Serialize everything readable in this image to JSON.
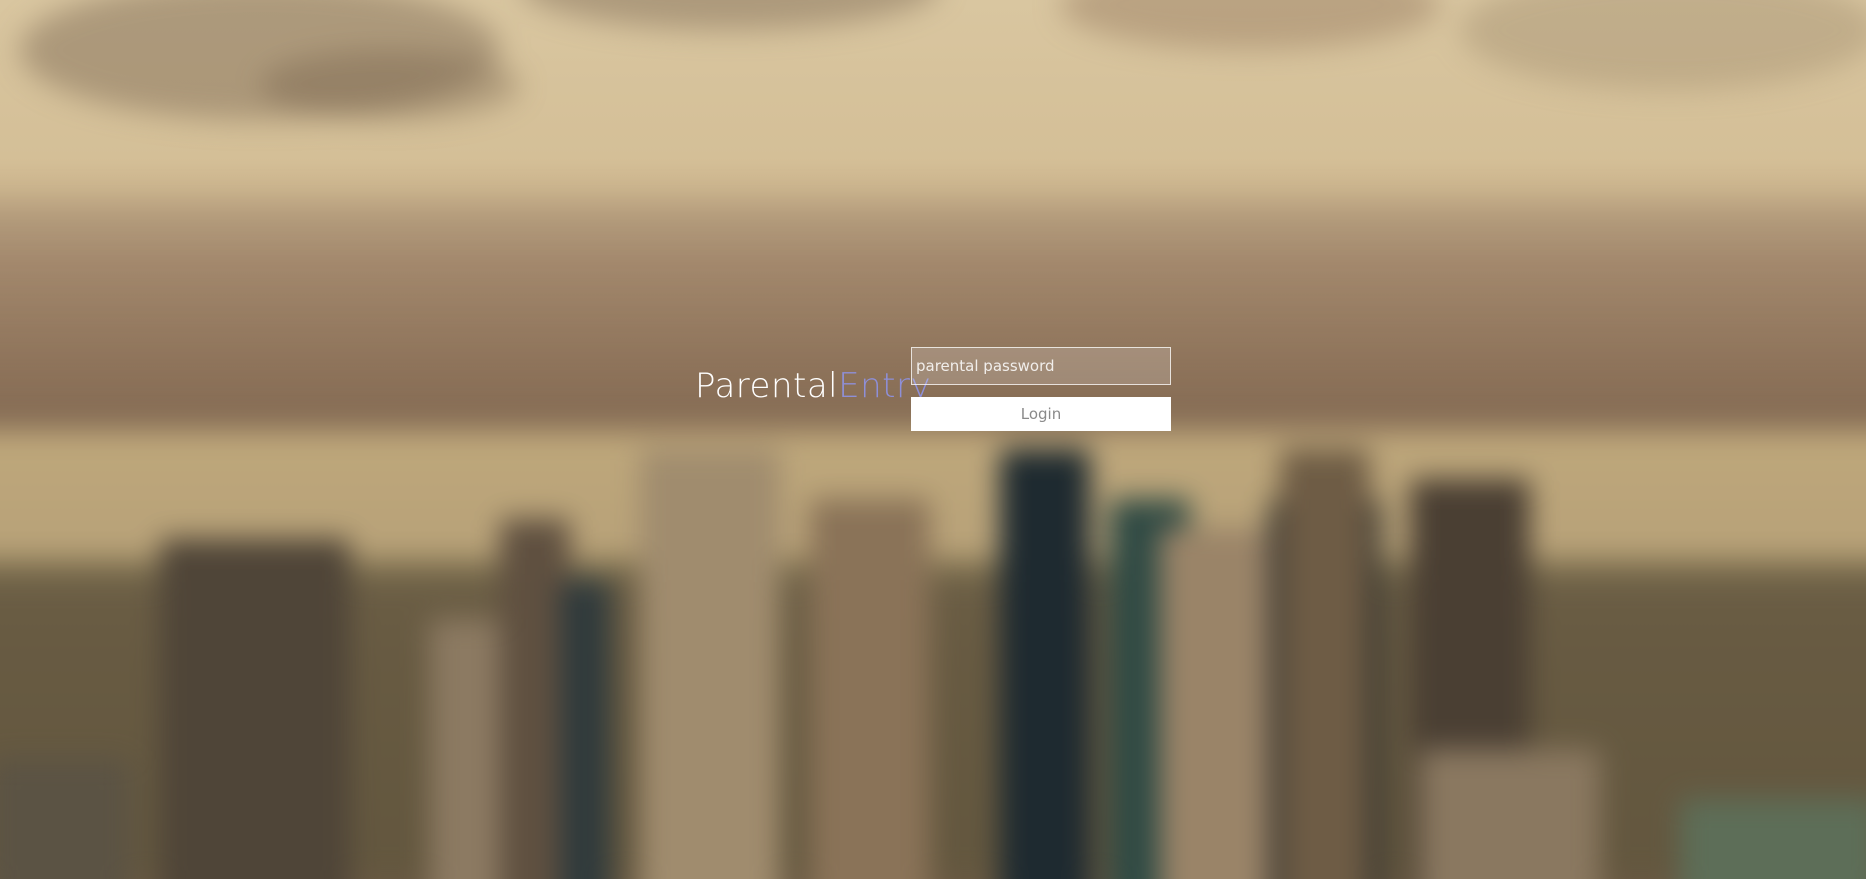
{
  "brand": {
    "part1": "Parental",
    "part2": "Entry"
  },
  "login_form": {
    "password_placeholder": "parental password",
    "password_value": "",
    "login_label": "Login"
  },
  "colors": {
    "brand_accent": "#8e8fd8",
    "button_bg": "#ffffff",
    "button_text": "#8a8a8a"
  },
  "background": {
    "description_icon": "blurred-city-skyline-image"
  }
}
